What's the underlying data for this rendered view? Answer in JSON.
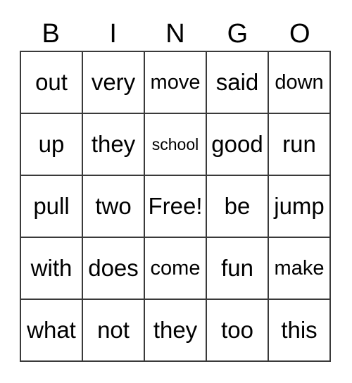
{
  "card": {
    "title": "BINGO",
    "headers": [
      "B",
      "I",
      "N",
      "G",
      "O"
    ],
    "rows": [
      [
        {
          "text": "out",
          "size": "lg"
        },
        {
          "text": "very",
          "size": "lg"
        },
        {
          "text": "move",
          "size": "md"
        },
        {
          "text": "said",
          "size": "lg"
        },
        {
          "text": "down",
          "size": "md"
        }
      ],
      [
        {
          "text": "up",
          "size": "lg"
        },
        {
          "text": "they",
          "size": "lg"
        },
        {
          "text": "school",
          "size": "sm"
        },
        {
          "text": "good",
          "size": "lg"
        },
        {
          "text": "run",
          "size": "lg"
        }
      ],
      [
        {
          "text": "pull",
          "size": "lg"
        },
        {
          "text": "two",
          "size": "lg"
        },
        {
          "text": "Free!",
          "size": "lg"
        },
        {
          "text": "be",
          "size": "lg"
        },
        {
          "text": "jump",
          "size": "lg"
        }
      ],
      [
        {
          "text": "with",
          "size": "lg"
        },
        {
          "text": "does",
          "size": "lg"
        },
        {
          "text": "come",
          "size": "md"
        },
        {
          "text": "fun",
          "size": "lg"
        },
        {
          "text": "make",
          "size": "md"
        }
      ],
      [
        {
          "text": "what",
          "size": "lg"
        },
        {
          "text": "not",
          "size": "lg"
        },
        {
          "text": "they",
          "size": "lg"
        },
        {
          "text": "too",
          "size": "lg"
        },
        {
          "text": "this",
          "size": "lg"
        }
      ]
    ],
    "free_space": {
      "row": 2,
      "col": 2,
      "label": "Free!"
    },
    "colors": {
      "background": "#ffffff",
      "text": "#000000",
      "border": "#3a3a3a"
    }
  }
}
